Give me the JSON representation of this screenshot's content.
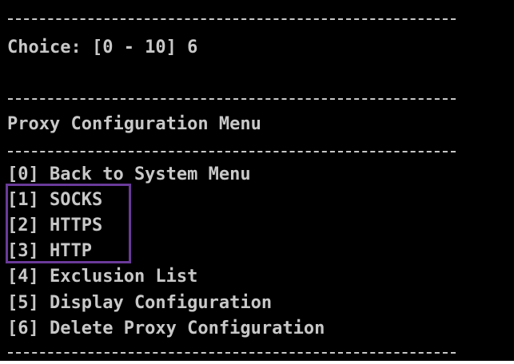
{
  "terminal": {
    "choice_prompt": "Choice: [0 - 10] 6",
    "menu_title": "Proxy Configuration Menu",
    "menu_items": [
      "[0] Back to System Menu",
      "[1] SOCKS",
      "[2] HTTPS",
      "[3] HTTP",
      "[4] Exclusion List",
      "[5] Display Configuration",
      "[6] Delete Proxy Configuration"
    ]
  },
  "colors": {
    "background": "#000000",
    "text": "#c8c8c8",
    "highlight_border": "#6a3a9a",
    "page_background": "#ffffff"
  }
}
